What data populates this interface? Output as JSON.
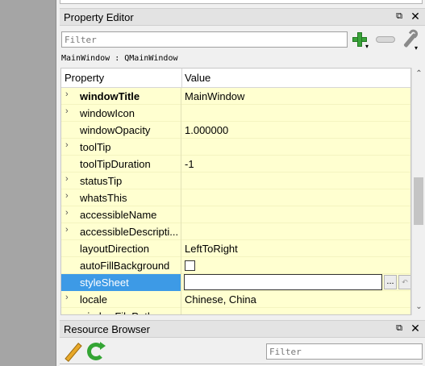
{
  "property_editor": {
    "title": "Property Editor",
    "filter_placeholder": "Filter",
    "object_label": "MainWindow : QMainWindow",
    "columns": {
      "property": "Property",
      "value": "Value"
    },
    "rows": [
      {
        "name": "windowTitle",
        "value": "MainWindow",
        "expandable": true,
        "bold": true
      },
      {
        "name": "windowIcon",
        "value": "",
        "expandable": true
      },
      {
        "name": "windowOpacity",
        "value": "1.000000",
        "expandable": false
      },
      {
        "name": "toolTip",
        "value": "",
        "expandable": true
      },
      {
        "name": "toolTipDuration",
        "value": "-1",
        "expandable": false
      },
      {
        "name": "statusTip",
        "value": "",
        "expandable": true
      },
      {
        "name": "whatsThis",
        "value": "",
        "expandable": true
      },
      {
        "name": "accessibleName",
        "value": "",
        "expandable": true
      },
      {
        "name": "accessibleDescripti...",
        "value": "",
        "expandable": true
      },
      {
        "name": "layoutDirection",
        "value": "LeftToRight",
        "expandable": false
      },
      {
        "name": "autoFillBackground",
        "value": "",
        "expandable": false,
        "checkbox": true
      },
      {
        "name": "styleSheet",
        "value": "",
        "expandable": false,
        "selected": true,
        "editor": true
      },
      {
        "name": "locale",
        "value": "Chinese, China",
        "expandable": true
      },
      {
        "name": "windowFilePath",
        "value": "",
        "expandable": true,
        "partial": true
      }
    ],
    "ellipsis_button": "...",
    "expand_glyph": "›",
    "collapse_glyph": "⌄"
  },
  "resource_browser": {
    "title": "Resource Browser",
    "filter_placeholder": "Filter"
  },
  "icons": {
    "float": "⧉",
    "close": "✕",
    "scroll_up": "⌃",
    "scroll_down": "⌄",
    "reset": "↶"
  },
  "colors": {
    "row_background": "#ffffd0",
    "selected": "#3d9ae6",
    "add_green": "#3aa33a"
  }
}
